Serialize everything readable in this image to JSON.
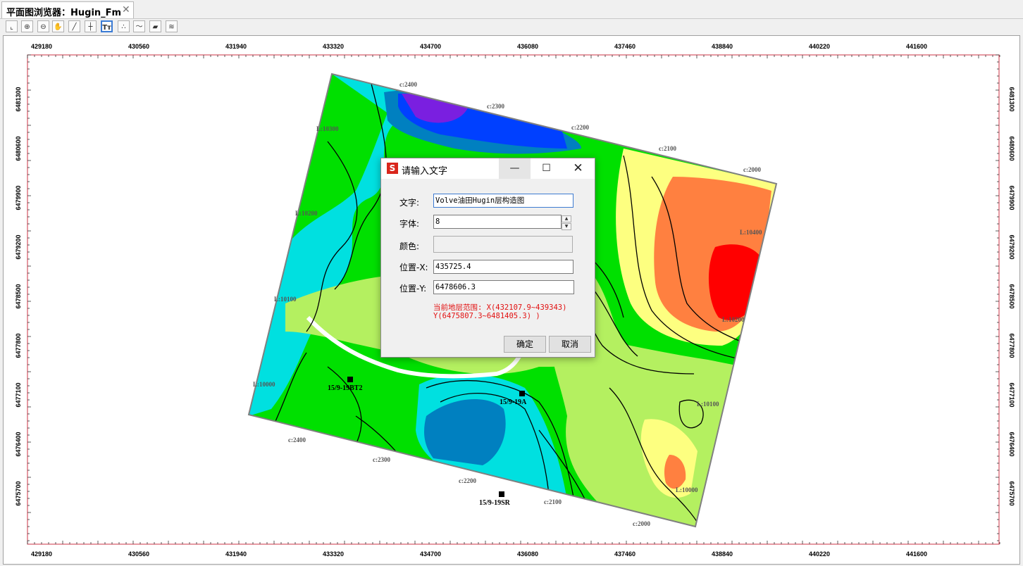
{
  "tab": {
    "title": "平面图浏览器：Hugin_Fm",
    "close": "✕"
  },
  "toolbar": {
    "tools": [
      {
        "name": "fit-extent-icon",
        "glyph": "⌞"
      },
      {
        "name": "zoom-in-icon",
        "glyph": "⊕"
      },
      {
        "name": "zoom-out-icon",
        "glyph": "⊖"
      },
      {
        "name": "pan-hand-icon",
        "glyph": "✋"
      },
      {
        "name": "draw-line-icon",
        "glyph": "╱"
      },
      {
        "name": "crosshair-icon",
        "glyph": "┼"
      },
      {
        "name": "text-tool-icon",
        "glyph": "Tт",
        "active": true
      },
      {
        "name": "scatter-points-icon",
        "glyph": "∴"
      },
      {
        "name": "polyline-icon",
        "glyph": "〜"
      },
      {
        "name": "color-fill-icon",
        "glyph": "▰"
      },
      {
        "name": "contour-lines-icon",
        "glyph": "≋"
      }
    ]
  },
  "map": {
    "x_ticks": [
      "429180",
      "430560",
      "431940",
      "433320",
      "434700",
      "436080",
      "437460",
      "438840",
      "440220",
      "441600"
    ],
    "y_ticks": [
      "6481300",
      "6480600",
      "6479900",
      "6479200",
      "6478500",
      "6477800",
      "6477100",
      "6476400",
      "6475700"
    ],
    "wells": [
      {
        "name": "15/9-19BT2"
      },
      {
        "name": "15/9-19A"
      },
      {
        "name": "15/9-19SR"
      }
    ],
    "labels": [
      "c:2400",
      "c:2300",
      "c:2200",
      "c:2100",
      "c:2000",
      "L:10300",
      "L:10200",
      "L:10100",
      "L:10000",
      "L:10400",
      "c:2400",
      "c:2300",
      "c:2200",
      "c:2100",
      "c:2000",
      "L:10100",
      "L:10000",
      "L:10200"
    ],
    "colors": {
      "border": "#cc3344",
      "frame": "#808080",
      "high": "#ff0000",
      "low": "#7a1fe0"
    }
  },
  "dialog": {
    "title": "请输入文字",
    "logo": "S",
    "min": "—",
    "max": "☐",
    "close": "✕",
    "text_label": "文字:",
    "text_value": "Volve油田Hugin层构造图",
    "font_label": "字体:",
    "font_value": "8",
    "color_label": "颜色:",
    "x_label": "位置-X:",
    "x_value": "435725.4",
    "y_label": "位置-Y:",
    "y_value": "6478606.3",
    "range_line1": "当前地层范围: X(432107.9~439343)",
    "range_line2": "Y(6475807.3~6481405.3) )",
    "ok": "确定",
    "cancel": "取消"
  }
}
